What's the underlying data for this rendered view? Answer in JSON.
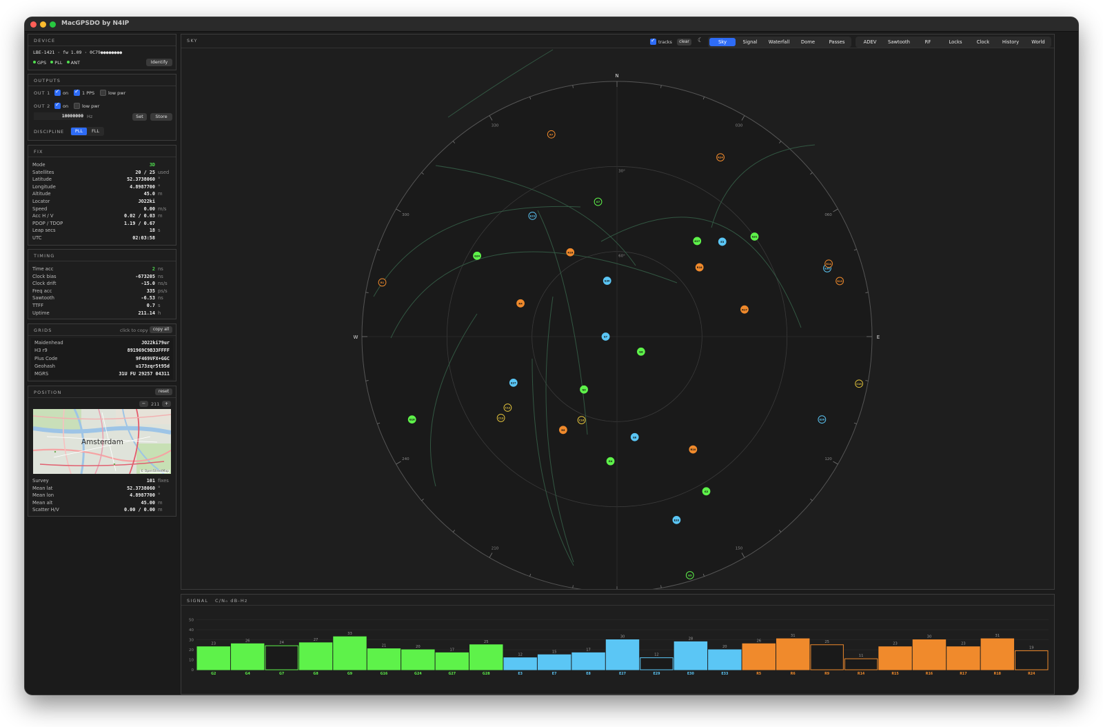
{
  "window_title": "MacGPSDO by N4IP",
  "device": {
    "header": "DEVICE",
    "info": "LBE-1421 · fw 1.09 · 0C79●●●●●●●●",
    "status": [
      "GPS",
      "PLL",
      "ANT"
    ],
    "identify_label": "Identify"
  },
  "outputs": {
    "header": "OUTPUTS",
    "out1_label": "OUT 1",
    "out2_label": "OUT 2",
    "on_label": "on",
    "pps_label": "1 PPS",
    "lowpwr_label": "low pwr",
    "freq_value": "10000000",
    "freq_unit": "Hz",
    "set_label": "Set",
    "store_label": "Store",
    "discipline_label": "DISCIPLINE",
    "pll_label": "PLL",
    "fll_label": "FLL"
  },
  "fix": {
    "header": "FIX",
    "rows": [
      {
        "k": "Mode",
        "v": "3D",
        "u": ""
      },
      {
        "k": "Satellites",
        "v": "20 / 25",
        "u": "used"
      },
      {
        "k": "Latitude",
        "v": "52.3738060",
        "u": "°"
      },
      {
        "k": "Longitude",
        "v": "4.8987700",
        "u": "°"
      },
      {
        "k": "Altitude",
        "v": "45.0",
        "u": "m"
      },
      {
        "k": "Locator",
        "v": "JO22ki",
        "u": ""
      },
      {
        "k": "Speed",
        "v": "0.00",
        "u": "m/s"
      },
      {
        "k": "Acc H / V",
        "v": "0.02 / 0.03",
        "u": "m"
      },
      {
        "k": "PDOP / TDOP",
        "v": "1.19 / 0.67",
        "u": ""
      },
      {
        "k": "Leap secs",
        "v": "18",
        "u": "s"
      },
      {
        "k": "UTC",
        "v": "02:03:58",
        "u": ""
      }
    ]
  },
  "timing": {
    "header": "TIMING",
    "rows": [
      {
        "k": "Time acc",
        "v": "2",
        "u": "ns"
      },
      {
        "k": "Clock bias",
        "v": "-673205",
        "u": "ns"
      },
      {
        "k": "Clock drift",
        "v": "-15.0",
        "u": "ns/s"
      },
      {
        "k": "Freq acc",
        "v": "335",
        "u": "ps/s"
      },
      {
        "k": "Sawtooth",
        "v": "-6.53",
        "u": "ns"
      },
      {
        "k": "TTFF",
        "v": "0.7",
        "u": "s"
      },
      {
        "k": "Uptime",
        "v": "211.14",
        "u": "h"
      }
    ]
  },
  "grids": {
    "header": "GRIDS",
    "hint": "click to copy",
    "copy_all_label": "copy all",
    "rows": [
      {
        "k": "Maidenhead",
        "v": "JO22ki79ur"
      },
      {
        "k": "H3 r9",
        "v": "891969C9B33FFFF"
      },
      {
        "k": "Plus Code",
        "v": "9F469VFX+GGC"
      },
      {
        "k": "Geohash",
        "v": "u173zqr5t95d"
      },
      {
        "k": "MGRS",
        "v": "31U FU 29257 04311"
      }
    ]
  },
  "position": {
    "header": "POSITION",
    "reset_label": "reset",
    "zoom_minus": "−",
    "zoom_value": "211",
    "zoom_plus": "+",
    "map_city": "Amsterdam",
    "map_credit": "© OpenStreetMap",
    "rows": [
      {
        "k": "Survey",
        "v": "101",
        "u": "fixes"
      },
      {
        "k": "Mean lat",
        "v": "52.3738060",
        "u": "°"
      },
      {
        "k": "Mean lon",
        "v": "4.8987700",
        "u": "°"
      },
      {
        "k": "Mean alt",
        "v": "45.00",
        "u": "m"
      },
      {
        "k": "Scatter H/V",
        "v": "0.00 / 0.00",
        "u": "m"
      }
    ]
  },
  "sky": {
    "header": "SKY",
    "tracks_label": "tracks",
    "clear_label": "clear",
    "moon_icon": "moon-icon",
    "tabs_group1": [
      "Sky",
      "Signal",
      "Waterfall",
      "Dome",
      "Passes"
    ],
    "tabs_group2": [
      "ADEV",
      "Sawtooth",
      "RF",
      "Locks",
      "Clock",
      "History",
      "World"
    ],
    "active_tab": "Sky",
    "compass": {
      "N": "N",
      "E": "E",
      "S": "S",
      "W": "W"
    },
    "elev_labels": [
      "30°",
      "60°"
    ],
    "azimuth_labels": [
      {
        "az": 30,
        "t": "030"
      },
      {
        "az": 60,
        "t": "060"
      },
      {
        "az": 120,
        "t": "120"
      },
      {
        "az": 150,
        "t": "150"
      },
      {
        "az": 210,
        "t": "210"
      },
      {
        "az": 240,
        "t": "240"
      },
      {
        "az": 300,
        "t": "300"
      },
      {
        "az": 330,
        "t": "330"
      }
    ],
    "colors": {
      "gps": "#5ef24a",
      "gal": "#5bc6f5",
      "glo": "#f08a2c",
      "bds": "#e2c23c"
    }
  },
  "satellites": [
    {
      "id": "G24",
      "sys": "gps",
      "used": true,
      "az": 300,
      "el": 33
    },
    {
      "id": "G7",
      "sys": "gps",
      "used": false,
      "az": 352,
      "el": 42
    },
    {
      "id": "G27",
      "sys": "gps",
      "used": true,
      "az": 40,
      "el": 46
    },
    {
      "id": "G31",
      "sys": "gps",
      "used": true,
      "az": 54,
      "el": 30
    },
    {
      "id": "G8",
      "sys": "gps",
      "used": true,
      "az": 122,
      "el": 80
    },
    {
      "id": "G9",
      "sys": "gps",
      "used": true,
      "az": 212,
      "el": 68
    },
    {
      "id": "G16",
      "sys": "gps",
      "used": true,
      "az": 248,
      "el": 12
    },
    {
      "id": "G4",
      "sys": "gps",
      "used": true,
      "az": 183,
      "el": 46
    },
    {
      "id": "G2",
      "sys": "gps",
      "used": true,
      "az": 150,
      "el": 27
    },
    {
      "id": "G5",
      "sys": "gps",
      "used": false,
      "az": 163,
      "el": 2
    },
    {
      "id": "E29",
      "sys": "gal",
      "used": false,
      "az": 325,
      "el": 38
    },
    {
      "id": "E30",
      "sys": "gal",
      "used": true,
      "az": 350,
      "el": 70
    },
    {
      "id": "E3",
      "sys": "gal",
      "used": true,
      "az": 48,
      "el": 40
    },
    {
      "id": "E36",
      "sys": "gal",
      "used": false,
      "az": 72,
      "el": 12
    },
    {
      "id": "E7",
      "sys": "gal",
      "used": true,
      "az": 270,
      "el": 86
    },
    {
      "id": "E27",
      "sys": "gal",
      "used": true,
      "az": 246,
      "el": 50
    },
    {
      "id": "E8",
      "sys": "gal",
      "used": true,
      "az": 170,
      "el": 54
    },
    {
      "id": "E33",
      "sys": "gal",
      "used": true,
      "az": 162,
      "el": 22
    },
    {
      "id": "E26",
      "sys": "gal",
      "used": false,
      "az": 112,
      "el": 12
    },
    {
      "id": "R7",
      "sys": "glo",
      "used": false,
      "az": 342,
      "el": 15
    },
    {
      "id": "R24",
      "sys": "glo",
      "used": false,
      "az": 30,
      "el": 17
    },
    {
      "id": "R18",
      "sys": "glo",
      "used": true,
      "az": 50,
      "el": 52
    },
    {
      "id": "R16",
      "sys": "glo",
      "used": true,
      "az": 331,
      "el": 56
    },
    {
      "id": "R4",
      "sys": "glo",
      "used": true,
      "az": 289,
      "el": 54
    },
    {
      "id": "R17",
      "sys": "glo",
      "used": true,
      "az": 78,
      "el": 44
    },
    {
      "id": "R13",
      "sys": "glo",
      "used": false,
      "az": 76,
      "el": 9
    },
    {
      "id": "R1",
      "sys": "glo",
      "used": false,
      "az": 283,
      "el": 5
    },
    {
      "id": "R10",
      "sys": "glo",
      "used": true,
      "az": 146,
      "el": 42
    },
    {
      "id": "R5",
      "sys": "glo",
      "used": true,
      "az": 210,
      "el": 52
    },
    {
      "id": "R14",
      "sys": "glo",
      "used": false,
      "az": 71,
      "el": 11
    },
    {
      "id": "C13",
      "sys": "bds",
      "used": false,
      "az": 235,
      "el": 40
    },
    {
      "id": "C12",
      "sys": "bds",
      "used": false,
      "az": 237,
      "el": 44
    },
    {
      "id": "C16",
      "sys": "bds",
      "used": false,
      "az": 203,
      "el": 58
    },
    {
      "id": "C19",
      "sys": "bds",
      "used": false,
      "az": 101,
      "el": 3
    }
  ],
  "tracks": [
    "M 648,180 Q 720,130 800,82",
    "M 630,250 Q 840,280 920,395",
    "M 540,440 Q 620,300 840,310",
    "M 565,500 Q 660,300 980,420",
    "M 870,360 Q 1070,250 1160,485",
    "M 1030,340 Q 1060,230 1180,220",
    "M 778,315 Q 830,420 850,640",
    "M 800,440 Q 770,650 830,825",
    "M 690,465 Q 600,600 630,715",
    "M 770,530 Q 770,720 830,830"
  ],
  "signal": {
    "header": "SIGNAL",
    "unit": "C/N₀ dB-Hz",
    "y_ticks": [
      0,
      10,
      20,
      30,
      40,
      50
    ],
    "bars": [
      {
        "id": "G2",
        "v": 23,
        "sys": "gps",
        "used": true
      },
      {
        "id": "G4",
        "v": 26,
        "sys": "gps",
        "used": true
      },
      {
        "id": "G7",
        "v": 24,
        "sys": "gps",
        "used": false
      },
      {
        "id": "G8",
        "v": 27,
        "sys": "gps",
        "used": true
      },
      {
        "id": "G9",
        "v": 33,
        "sys": "gps",
        "used": true
      },
      {
        "id": "G16",
        "v": 21,
        "sys": "gps",
        "used": true
      },
      {
        "id": "G24",
        "v": 20,
        "sys": "gps",
        "used": true
      },
      {
        "id": "G27",
        "v": 17,
        "sys": "gps",
        "used": true
      },
      {
        "id": "G28",
        "v": 25,
        "sys": "gps",
        "used": true
      },
      {
        "id": "E3",
        "v": 12,
        "sys": "gal",
        "used": true
      },
      {
        "id": "E7",
        "v": 15,
        "sys": "gal",
        "used": true
      },
      {
        "id": "E8",
        "v": 17,
        "sys": "gal",
        "used": true
      },
      {
        "id": "E27",
        "v": 30,
        "sys": "gal",
        "used": true
      },
      {
        "id": "E29",
        "v": 12,
        "sys": "gal",
        "used": false
      },
      {
        "id": "E30",
        "v": 28,
        "sys": "gal",
        "used": true
      },
      {
        "id": "E33",
        "v": 20,
        "sys": "gal",
        "used": true
      },
      {
        "id": "R5",
        "v": 26,
        "sys": "glo",
        "used": true
      },
      {
        "id": "R6",
        "v": 31,
        "sys": "glo",
        "used": true
      },
      {
        "id": "R9",
        "v": 25,
        "sys": "glo",
        "used": false
      },
      {
        "id": "R14",
        "v": 11,
        "sys": "glo",
        "used": false
      },
      {
        "id": "R15",
        "v": 23,
        "sys": "glo",
        "used": true
      },
      {
        "id": "R16",
        "v": 30,
        "sys": "glo",
        "used": true
      },
      {
        "id": "R17",
        "v": 23,
        "sys": "glo",
        "used": true
      },
      {
        "id": "R18",
        "v": 31,
        "sys": "glo",
        "used": true
      },
      {
        "id": "R24",
        "v": 19,
        "sys": "glo",
        "used": false
      }
    ]
  }
}
